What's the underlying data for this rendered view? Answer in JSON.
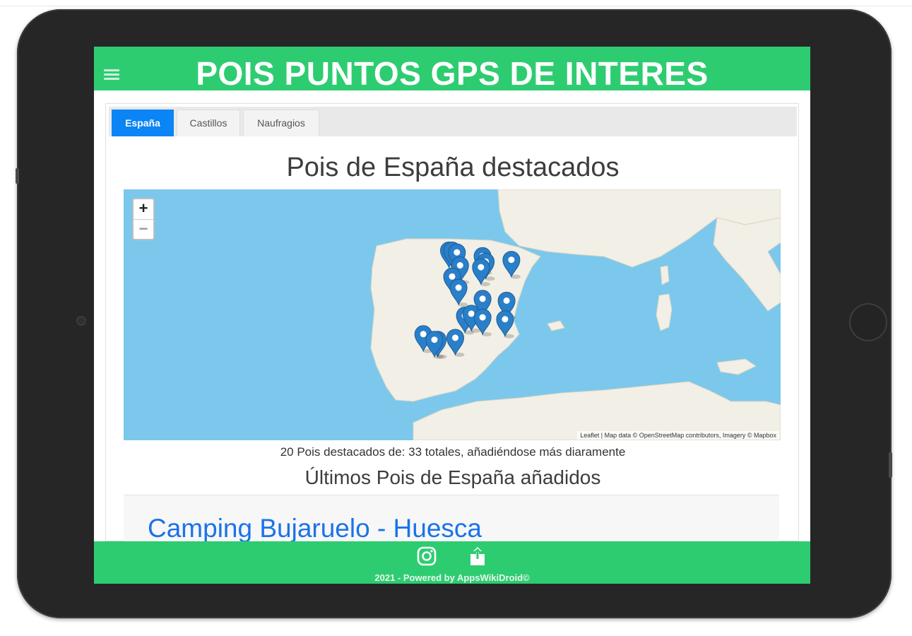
{
  "header": {
    "title": "POIS PUNTOS GPS DE INTERES",
    "menu_icon": "hamburger-menu-icon"
  },
  "tabs": [
    {
      "label": "España",
      "active": true
    },
    {
      "label": "Castillos",
      "active": false
    },
    {
      "label": "Naufragios",
      "active": false
    }
  ],
  "main": {
    "title": "Pois de España destacados",
    "map": {
      "zoom_in": "+",
      "zoom_out": "−",
      "attribution": "Leaflet | Map data © OpenStreetMap contributors, Imagery © Mapbox",
      "marker_icon": "map-marker-icon",
      "marker_color": "#2a7fc9",
      "markers": [
        {
          "lat": 43.3,
          "lon": -3.7
        },
        {
          "lat": 43.3,
          "lon": -3.5
        },
        {
          "lat": 43.2,
          "lon": -3.2
        },
        {
          "lat": 43.0,
          "lon": -1.6
        },
        {
          "lat": 42.7,
          "lon": -1.4
        },
        {
          "lat": 42.8,
          "lon": 0.2
        },
        {
          "lat": 42.5,
          "lon": -3.0
        },
        {
          "lat": 42.4,
          "lon": -1.7
        },
        {
          "lat": 41.9,
          "lon": -3.5
        },
        {
          "lat": 41.3,
          "lon": -3.1
        },
        {
          "lat": 40.7,
          "lon": -1.6
        },
        {
          "lat": 40.6,
          "lon": -0.1
        },
        {
          "lat": 39.8,
          "lon": -2.7
        },
        {
          "lat": 39.9,
          "lon": -2.3
        },
        {
          "lat": 39.7,
          "lon": -1.6
        },
        {
          "lat": 39.6,
          "lon": -0.2
        },
        {
          "lat": 38.8,
          "lon": -5.3
        },
        {
          "lat": 38.5,
          "lon": -4.4
        },
        {
          "lat": 38.6,
          "lon": -3.3
        },
        {
          "lat": 38.5,
          "lon": -4.6
        }
      ]
    },
    "count_text": "20 Pois destacados de: 33 totales, añadiéndose más diaramente",
    "latest_title": "Últimos Pois de España añadidos",
    "latest_items": [
      {
        "label": "Camping Bujaruelo - Huesca"
      }
    ]
  },
  "footer": {
    "instagram_icon": "instagram-icon",
    "share_icon": "share-icon",
    "text": "2021 - Powered by AppsWikiDroid©"
  },
  "colors": {
    "accent": "#2ecc71",
    "tab_active": "#0b84f6",
    "link": "#1a73e8",
    "sea": "#7bc8ec",
    "land": "#f2efe6"
  }
}
